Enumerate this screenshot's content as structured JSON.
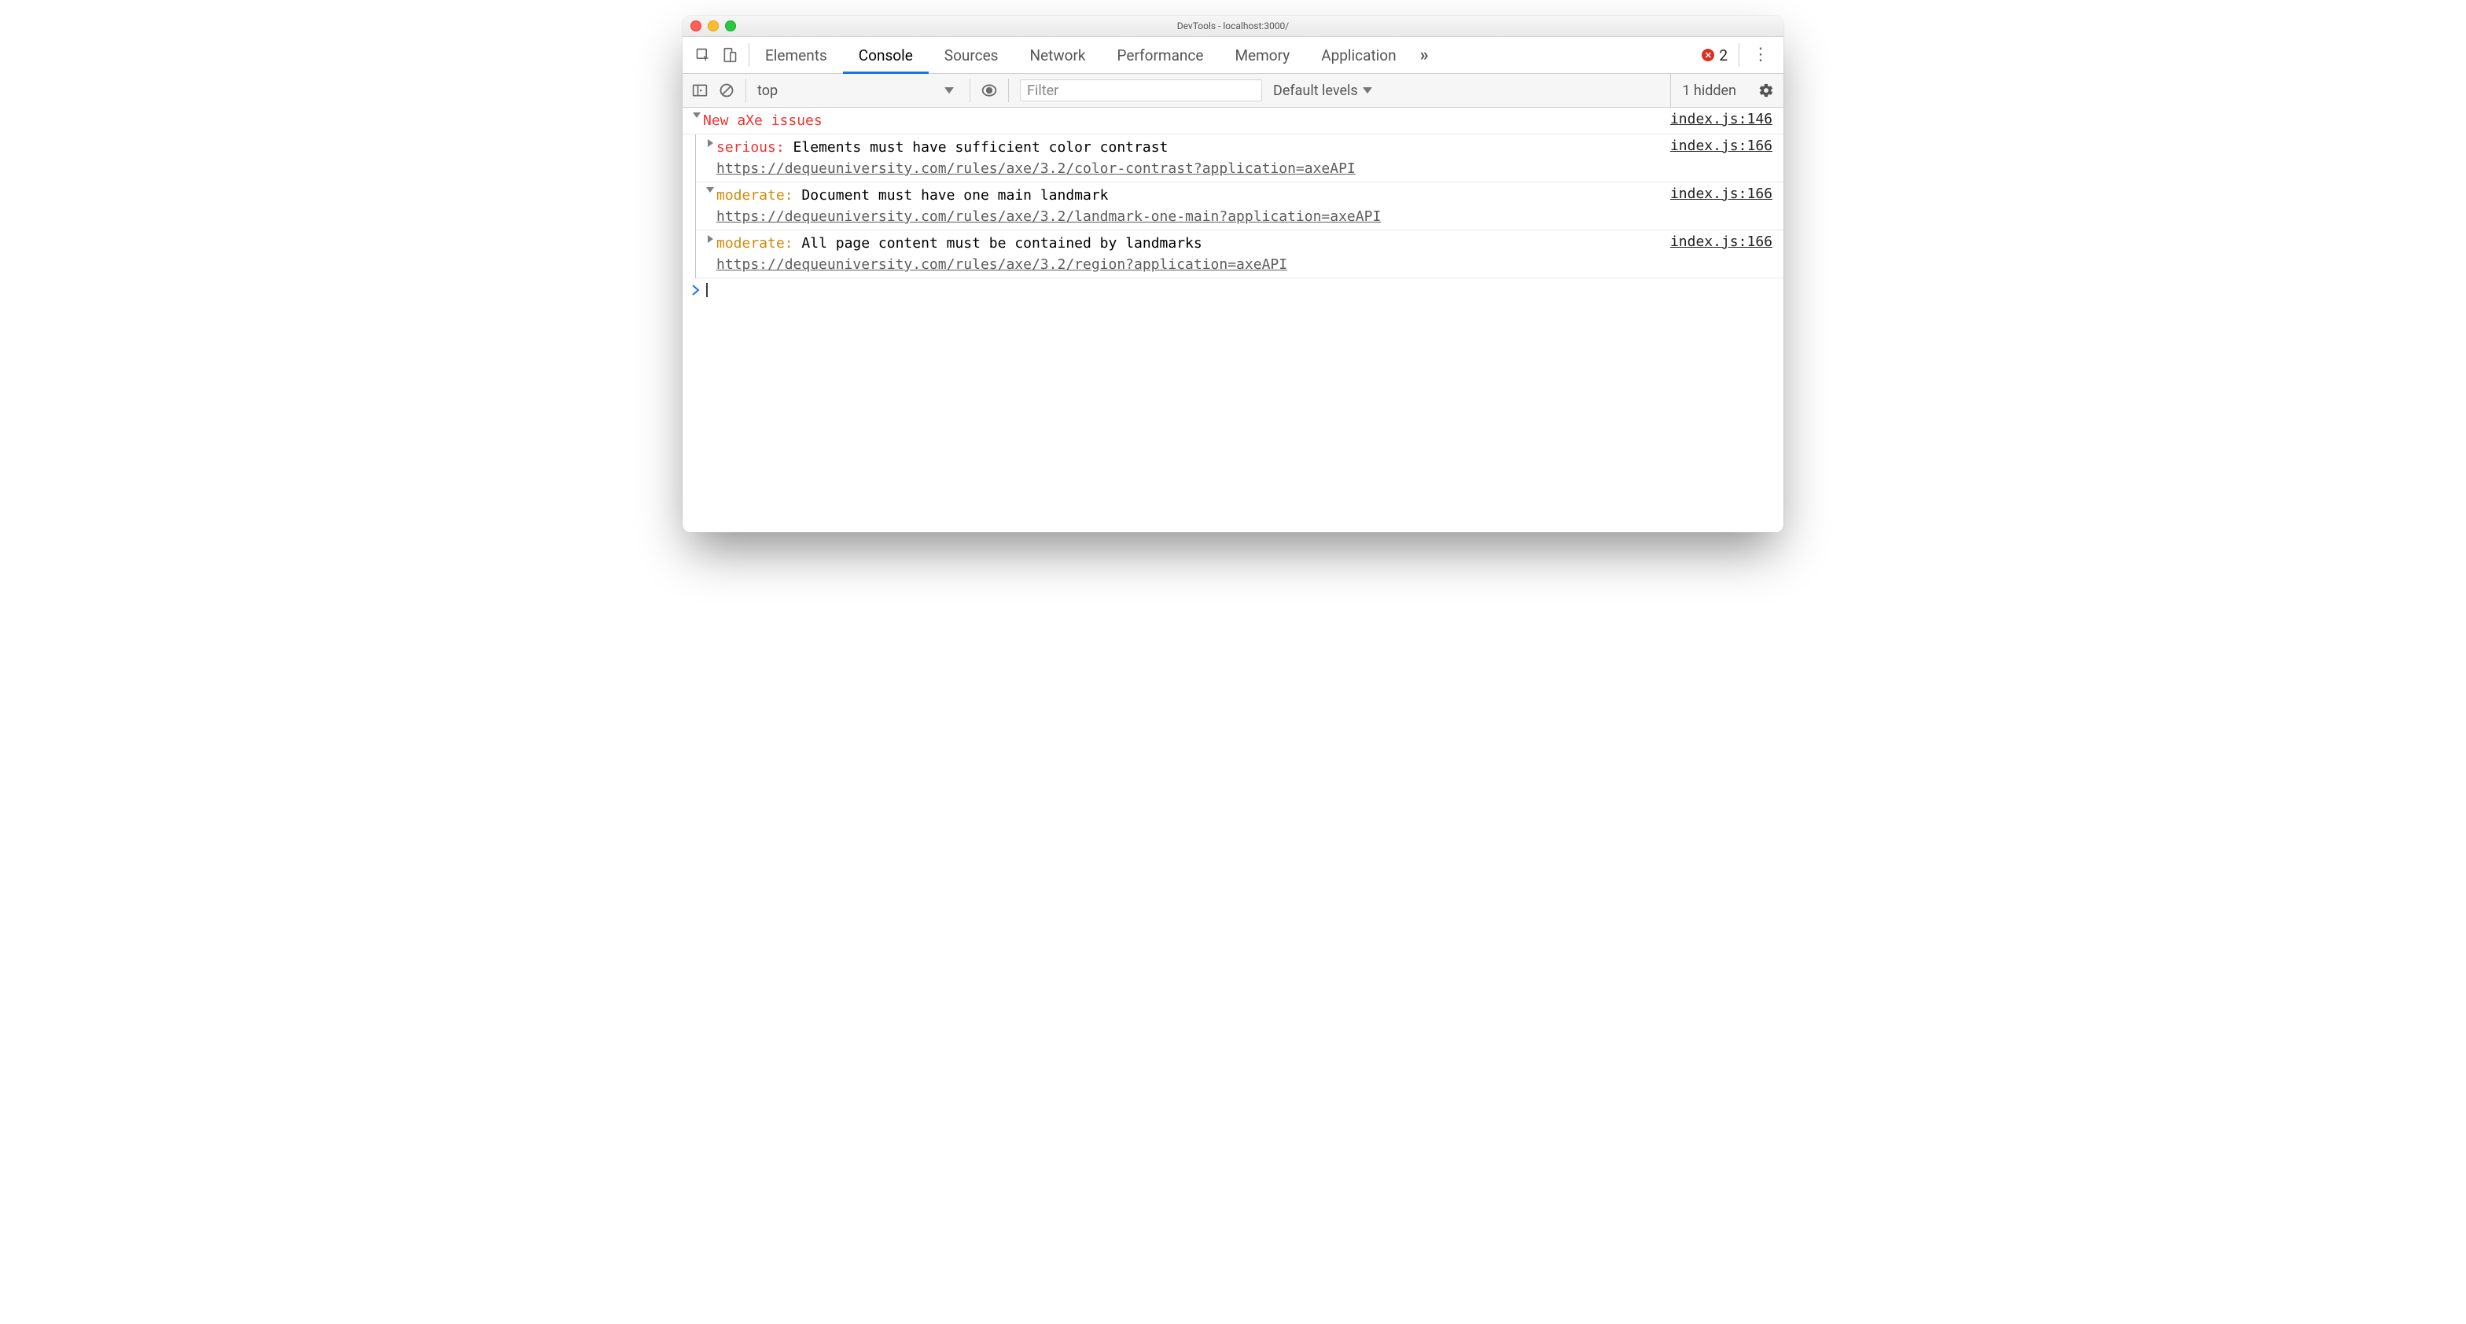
{
  "window": {
    "title": "DevTools - localhost:3000/"
  },
  "tabs": {
    "items": [
      "Elements",
      "Console",
      "Sources",
      "Network",
      "Performance",
      "Memory",
      "Application"
    ],
    "active_index": 1,
    "error_count": "2"
  },
  "toolbar": {
    "context": "top",
    "filter_placeholder": "Filter",
    "levels_label": "Default levels",
    "hidden_label": "1 hidden"
  },
  "console": {
    "group_label": "New aXe issues",
    "group_source": "index.js:146",
    "issues": [
      {
        "expanded": false,
        "severity": "serious",
        "message": "Elements must have sufficient color contrast",
        "url": "https://dequeuniversity.com/rules/axe/3.2/color-contrast?application=axeAPI",
        "source": "index.js:166"
      },
      {
        "expanded": true,
        "severity": "moderate",
        "message": "Document must have one main landmark",
        "url": "https://dequeuniversity.com/rules/axe/3.2/landmark-one-main?application=axeAPI",
        "source": "index.js:166"
      },
      {
        "expanded": false,
        "severity": "moderate",
        "message": "All page content must be contained by landmarks",
        "url": "https://dequeuniversity.com/rules/axe/3.2/region?application=axeAPI",
        "source": "index.js:166"
      }
    ]
  }
}
